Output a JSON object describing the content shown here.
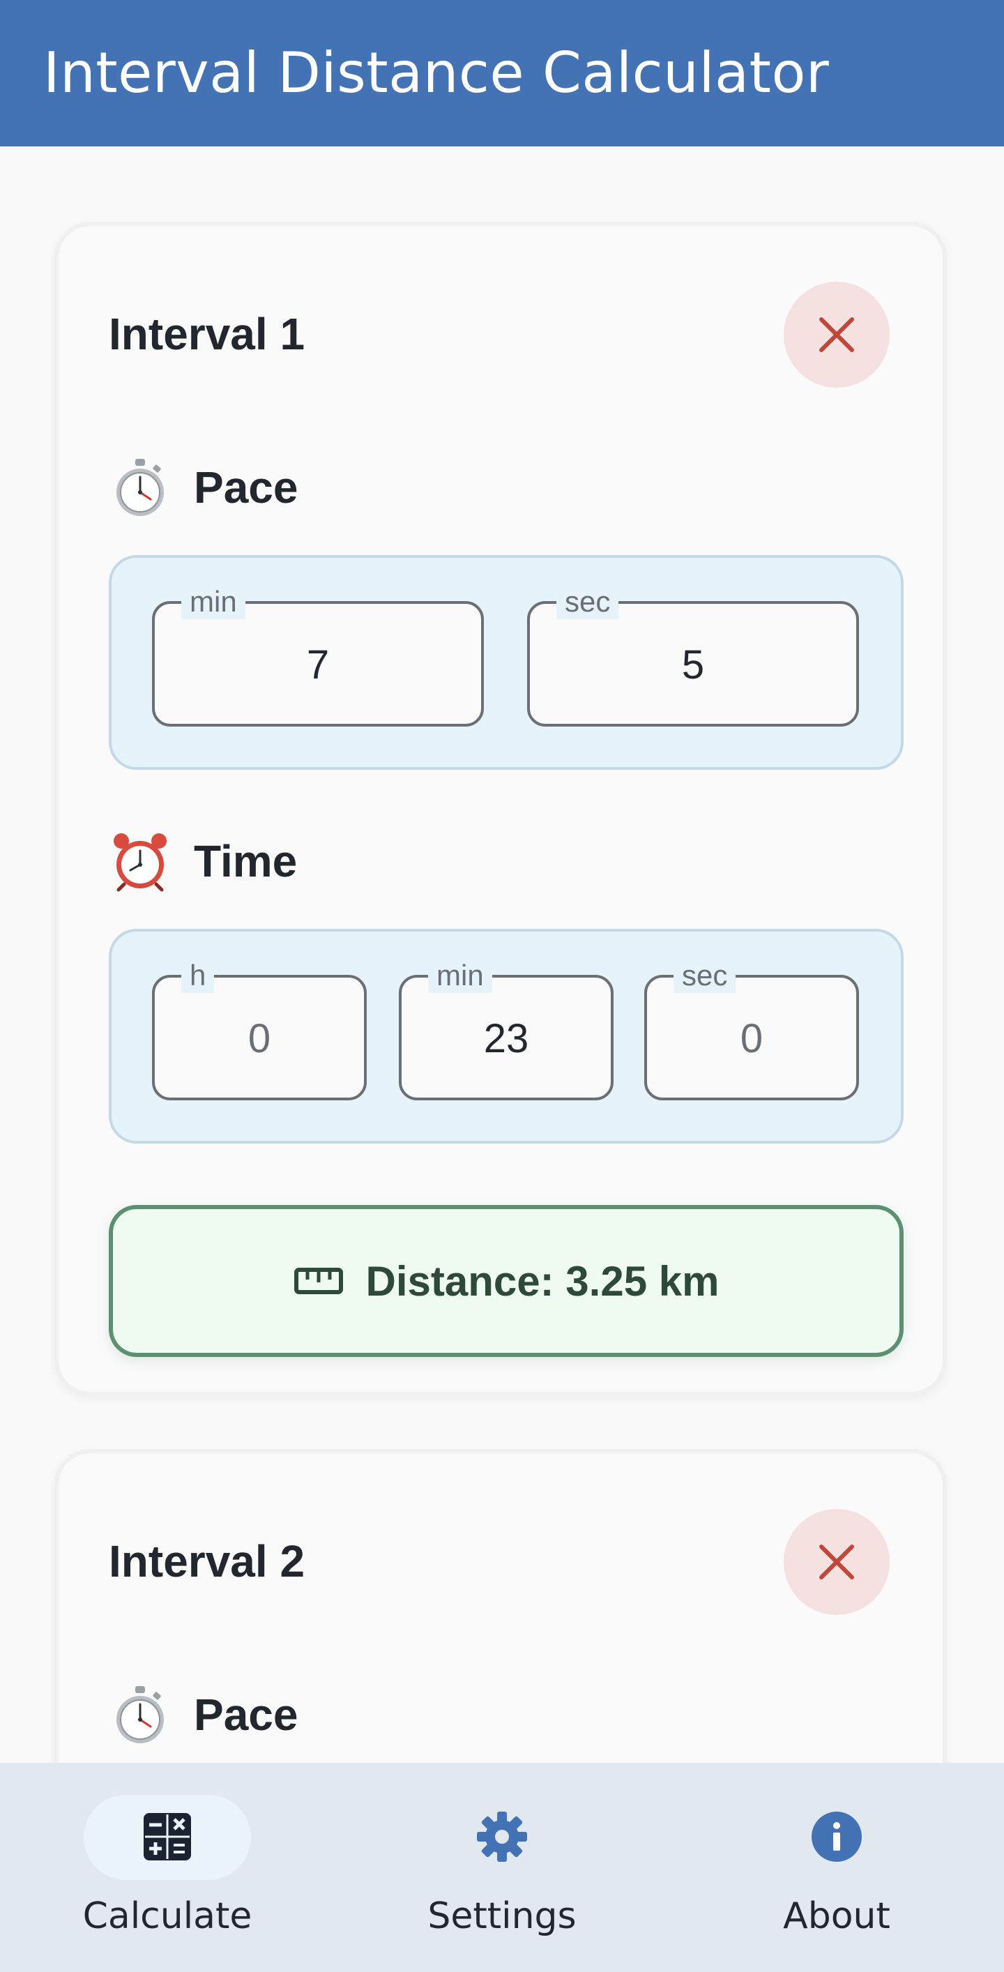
{
  "app": {
    "title": "Interval Distance Calculator"
  },
  "intervals": [
    {
      "title": "Interval 1",
      "pace": {
        "label": "Pace",
        "min_label": "min",
        "min_value": "7",
        "sec_label": "sec",
        "sec_value": "5"
      },
      "time": {
        "label": "Time",
        "h_label": "h",
        "h_value": "0",
        "min_label": "min",
        "min_value": "23",
        "sec_label": "sec",
        "sec_value": "0"
      },
      "distance": "Distance: 3.25 km"
    },
    {
      "title": "Interval 2",
      "pace": {
        "label": "Pace"
      }
    }
  ],
  "nav": {
    "items": [
      {
        "label": "Calculate",
        "icon": "calculator-icon",
        "selected": true
      },
      {
        "label": "Settings",
        "icon": "gear-icon",
        "selected": false
      },
      {
        "label": "About",
        "icon": "info-icon",
        "selected": false
      }
    ]
  },
  "colors": {
    "primary": "#4373b5",
    "remove_bg": "#f5e1df",
    "remove_icon": "#c2463a",
    "field_panel": "#e7f3fa",
    "distance_bg": "#effaf0",
    "distance_border": "#5b9170",
    "nav_bg": "#e1e8ef"
  }
}
